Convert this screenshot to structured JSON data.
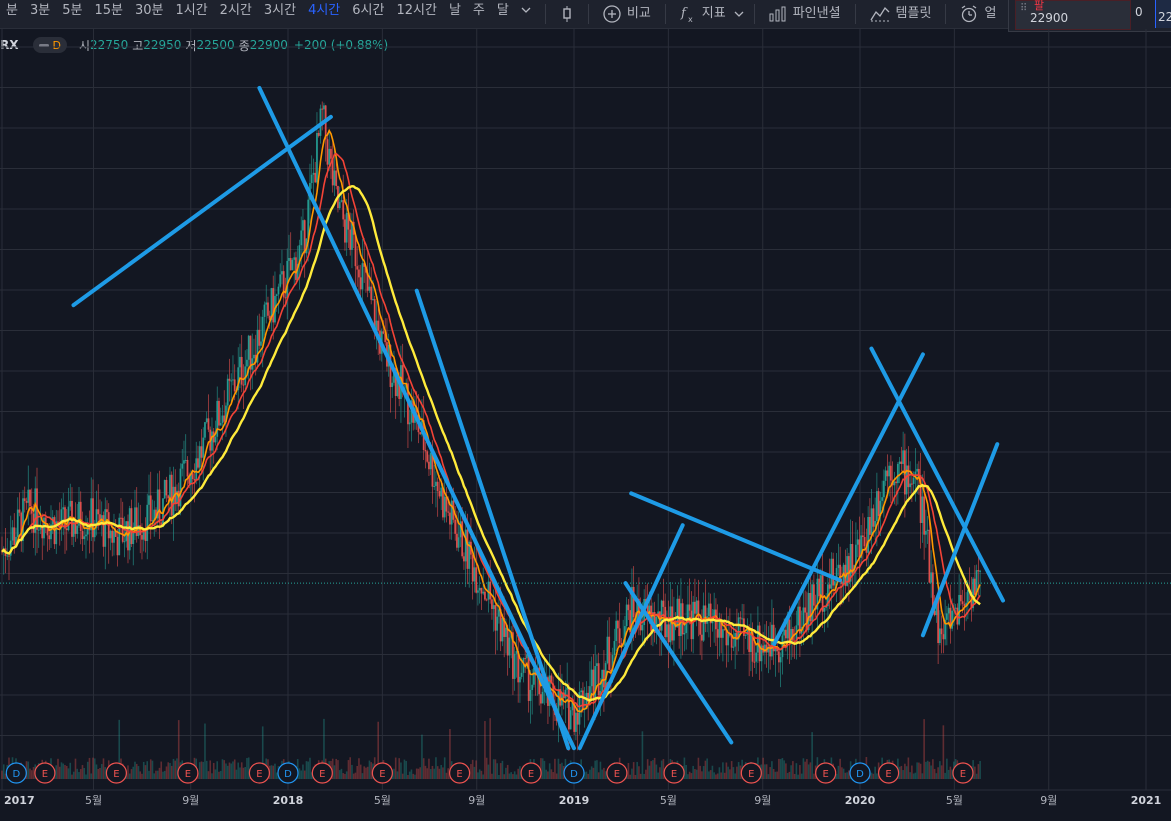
{
  "toolbar": {
    "timeframes": [
      "분",
      "3분",
      "5분",
      "15분",
      "30분",
      "1시간",
      "2시간",
      "3시간",
      "4시간",
      "6시간",
      "12시간",
      "날",
      "주",
      "달"
    ],
    "active_timeframe": "4시간",
    "compare_label": "비교",
    "indicators_label": "지표",
    "pine_label": "파인낸셜",
    "templates_label": "템플릿",
    "alert_label": "얼"
  },
  "quote_panel": {
    "label": "팔",
    "value": "22900",
    "spread": "0",
    "right_value": "22"
  },
  "legend": {
    "symbol": "RX",
    "interval_badge": "D",
    "open_label": "시",
    "open": "22750",
    "high_label": "고",
    "high": "22950",
    "low_label": "저",
    "low": "22500",
    "close_label": "종",
    "close": "22900",
    "change": "+200 (+0.88%)"
  },
  "colors": {
    "background": "#131722",
    "grid": "#2a2e39",
    "up": "#26a69a",
    "down": "#ef5350",
    "ma_fast": "#ff9800",
    "ma_mid": "#f44336",
    "ma_slow": "#ffeb3b",
    "trendline": "#1e9be6",
    "dividend": "#2196f3",
    "earnings": "#ef5350"
  },
  "chart_data": {
    "type": "candlestick",
    "x_axis_labels": [
      "2017",
      "5월",
      "9월",
      "2018",
      "5월",
      "9월",
      "2019",
      "5월",
      "9월",
      "2020",
      "5월",
      "9월",
      "2021"
    ],
    "close_series": [
      [
        2017.0,
        24.0
      ],
      [
        2017.1,
        25.5
      ],
      [
        2017.2,
        24.8
      ],
      [
        2017.3,
        25.2
      ],
      [
        2017.4,
        24.5
      ],
      [
        2017.55,
        25.4
      ],
      [
        2017.7,
        27.5
      ],
      [
        2017.8,
        29.5
      ],
      [
        2017.95,
        32.5
      ],
      [
        2018.05,
        34.5
      ],
      [
        2018.12,
        39.0
      ],
      [
        2018.17,
        36.0
      ],
      [
        2018.25,
        34.0
      ],
      [
        2018.33,
        31.0
      ],
      [
        2018.45,
        28.5
      ],
      [
        2018.55,
        25.5
      ],
      [
        2018.7,
        22.5
      ],
      [
        2018.8,
        20.0
      ],
      [
        2018.9,
        19.0
      ],
      [
        2019.0,
        18.5
      ],
      [
        2019.1,
        20.0
      ],
      [
        2019.2,
        22.0
      ],
      [
        2019.3,
        21.5
      ],
      [
        2019.4,
        21.8
      ],
      [
        2019.55,
        21.0
      ],
      [
        2019.65,
        20.8
      ],
      [
        2019.75,
        21.0
      ],
      [
        2019.85,
        22.5
      ],
      [
        2019.95,
        23.5
      ],
      [
        2020.0,
        24.0
      ],
      [
        2020.1,
        27.0
      ],
      [
        2020.2,
        26.5
      ],
      [
        2020.28,
        21.0
      ],
      [
        2020.33,
        22.0
      ],
      [
        2020.4,
        22.9
      ]
    ],
    "event_markers": [
      {
        "x": 2017.05,
        "label": "D",
        "kind": "dividend"
      },
      {
        "x": 2017.15,
        "label": "E",
        "kind": "earnings"
      },
      {
        "x": 2017.4,
        "label": "E",
        "kind": "earnings"
      },
      {
        "x": 2017.65,
        "label": "E",
        "kind": "earnings"
      },
      {
        "x": 2017.9,
        "label": "E",
        "kind": "earnings"
      },
      {
        "x": 2018.0,
        "label": "D",
        "kind": "dividend"
      },
      {
        "x": 2018.12,
        "label": "E",
        "kind": "earnings"
      },
      {
        "x": 2018.33,
        "label": "E",
        "kind": "earnings"
      },
      {
        "x": 2018.6,
        "label": "E",
        "kind": "earnings"
      },
      {
        "x": 2018.85,
        "label": "E",
        "kind": "earnings"
      },
      {
        "x": 2019.0,
        "label": "D",
        "kind": "dividend"
      },
      {
        "x": 2019.15,
        "label": "E",
        "kind": "earnings"
      },
      {
        "x": 2019.35,
        "label": "E",
        "kind": "earnings"
      },
      {
        "x": 2019.62,
        "label": "E",
        "kind": "earnings"
      },
      {
        "x": 2019.88,
        "label": "E",
        "kind": "earnings"
      },
      {
        "x": 2020.0,
        "label": "D",
        "kind": "dividend"
      },
      {
        "x": 2020.1,
        "label": "E",
        "kind": "earnings"
      },
      {
        "x": 2020.36,
        "label": "E",
        "kind": "earnings"
      }
    ],
    "trendlines": [
      [
        [
          2017.25,
          32.5
        ],
        [
          2018.15,
          39.0
        ]
      ],
      [
        [
          2017.9,
          40.0
        ],
        [
          2019.0,
          17.2
        ]
      ],
      [
        [
          2018.45,
          33.0
        ],
        [
          2018.98,
          17.2
        ]
      ],
      [
        [
          2019.02,
          17.2
        ],
        [
          2019.38,
          24.9
        ]
      ],
      [
        [
          2019.18,
          22.9
        ],
        [
          2019.55,
          17.4
        ]
      ],
      [
        [
          2019.2,
          26.0
        ],
        [
          2019.93,
          23.0
        ]
      ],
      [
        [
          2019.7,
          20.8
        ],
        [
          2020.22,
          30.8
        ]
      ],
      [
        [
          2020.04,
          31.0
        ],
        [
          2020.5,
          22.3
        ]
      ],
      [
        [
          2020.22,
          21.1
        ],
        [
          2020.48,
          27.7
        ]
      ]
    ]
  }
}
